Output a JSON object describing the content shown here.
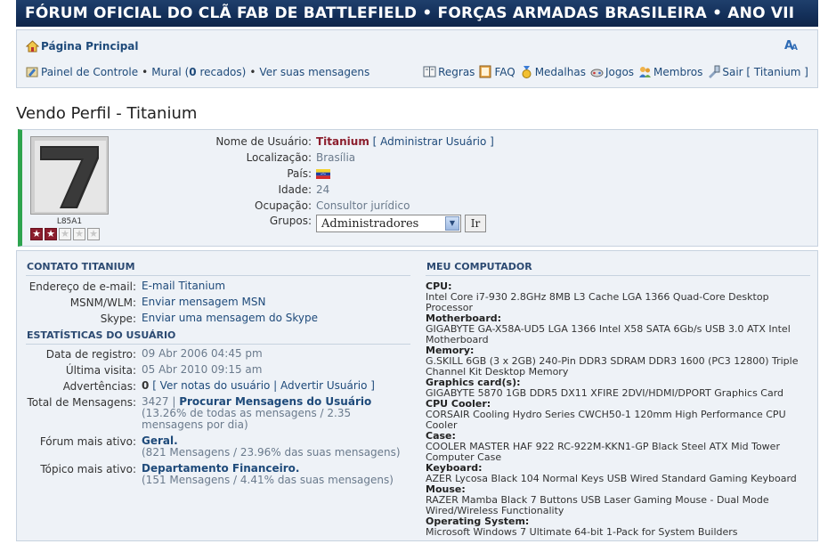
{
  "banner": {
    "title": "FÓRUM OFICIAL DO CLÃ FAB DE BATTLEFIELD • FORÇAS ARMADAS BRASILEIRA • ANO VII"
  },
  "nav": {
    "home": "Página Principal",
    "control_panel": "Painel de Controle",
    "mural_prefix": "Mural (",
    "mural_count": "0",
    "mural_suffix": " recados)",
    "view_messages": "Ver suas mensagens",
    "bullet": "•",
    "links": [
      {
        "label": "Regras",
        "icon": "rules-icon"
      },
      {
        "label": "FAQ",
        "icon": "faq-icon"
      },
      {
        "label": "Medalhas",
        "icon": "medal-icon"
      },
      {
        "label": "Jogos",
        "icon": "games-icon"
      },
      {
        "label": "Membros",
        "icon": "members-icon"
      },
      {
        "label": "Sair [ Titanium ]",
        "icon": "logout-icon"
      }
    ]
  },
  "page": {
    "title": "Vendo Perfil - Titanium"
  },
  "profile": {
    "avatar_caption": "L85A1",
    "avatar_number": "7",
    "rank_stars": {
      "filled": 2,
      "total": 5
    },
    "fields": {
      "username_label": "Nome de Usuário:",
      "username": "Titanium",
      "admin_link": "[ Administrar Usuário ]",
      "location_label": "Localização:",
      "location": "Brasília",
      "country_label": "País:",
      "country_flag": "venezuela-flag-icon",
      "age_label": "Idade:",
      "age": "24",
      "occupation_label": "Ocupação:",
      "occupation": "Consultor jurídico",
      "groups_label": "Grupos:",
      "groups_selected": "Administradores",
      "go_button": "Ir"
    }
  },
  "contact": {
    "title": "CONTATO TITANIUM",
    "email_label": "Endereço de e-mail:",
    "email": "E-mail Titanium",
    "msn_label": "MSNM/WLM:",
    "msn": "Enviar mensagem MSN",
    "skype_label": "Skype:",
    "skype": "Enviar uma mensagem do Skype"
  },
  "stats": {
    "title": "ESTATÍSTICAS DO USUÁRIO",
    "registered_label": "Data de registro:",
    "registered": "09 Abr 2006 04:45 pm",
    "last_visit_label": "Última visita:",
    "last_visit": "05 Abr 2010 09:15 am",
    "warnings_label": "Advertências:",
    "warnings_count": "0",
    "warnings_links": "[ Ver notas do usuário | Advertir Usuário ]",
    "total_label": "Total de Mensagens:",
    "total_count": "3427",
    "total_link": "Procurar Mensagens do Usuário",
    "total_detail": "(13.26% de todas as mensagens / 2.35 mensagens por dia)",
    "forum_label": "Fórum mais ativo:",
    "forum_name": "Geral.",
    "forum_detail": "(821 Mensagens / 23.96% das suas mensagens)",
    "topic_label": "Tópico mais ativo:",
    "topic_name": "Departamento Financeiro.",
    "topic_detail": "(151 Mensagens / 4.41% das suas mensagens)"
  },
  "computer": {
    "title": "MEU COMPUTADOR",
    "items": [
      {
        "label": "CPU:",
        "value": "Intel Core i7-930 2.8GHz 8MB L3 Cache LGA 1366 Quad-Core Desktop Processor"
      },
      {
        "label": "Motherboard:",
        "value": "GIGABYTE GA-X58A-UD5 LGA 1366 Intel X58 SATA 6Gb/s USB 3.0 ATX Intel Motherboard"
      },
      {
        "label": "Memory:",
        "value": "G.SKILL 6GB (3 x 2GB) 240-Pin DDR3 SDRAM DDR3 1600 (PC3 12800) Triple Channel Kit Desktop Memory"
      },
      {
        "label": "Graphics card(s):",
        "value": "GIGABYTE 5870 1GB DDR5 DX11 XFIRE 2DVI/HDMI/DPORT Graphics Card"
      },
      {
        "label": "CPU Cooler:",
        "value": "CORSAIR Cooling Hydro Series CWCH50-1 120mm High Performance CPU Cooler"
      },
      {
        "label": "Case:",
        "value": "COOLER MASTER HAF 922 RC-922M-KKN1-GP Black Steel ATX Mid Tower Computer Case"
      },
      {
        "label": "Keyboard:",
        "value": "AZER Lycosa Black 104 Normal Keys USB Wired Standard Gaming Keyboard"
      },
      {
        "label": "Mouse:",
        "value": "RAZER Mamba Black 7 Buttons USB Laser Gaming Mouse - Dual Mode Wired/Wireless Functionality"
      },
      {
        "label": "Operating System:",
        "value": "Microsoft Windows 7 Ultimate 64-bit 1-Pack for System Builders"
      }
    ]
  },
  "colors": {
    "banner": "#14305a",
    "link": "#1e4a7a",
    "username": "#8b1d2c",
    "accent_bar": "#2ea44f",
    "box_bg": "#eef2f7"
  }
}
